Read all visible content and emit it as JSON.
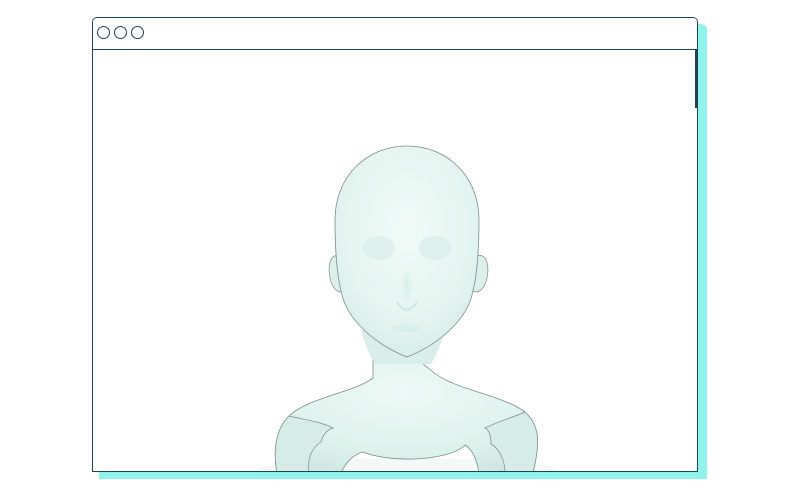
{
  "window": {
    "controls": [
      "close-control",
      "minimize-control",
      "maximize-control"
    ]
  },
  "viewport": {
    "subject": "3d-avatar-bust",
    "colors": {
      "frame": "#1d4454",
      "shadow": "#8ff3ec",
      "skin": "#e4f5f0",
      "skin_shade": "#c9e6df",
      "outline": "#6d7d79",
      "background": "#ffffff"
    }
  }
}
